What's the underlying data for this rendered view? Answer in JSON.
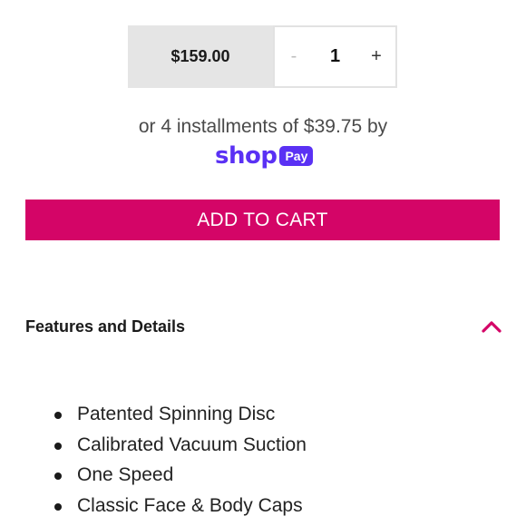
{
  "product": {
    "price": "$159.00",
    "quantity": {
      "minus_label": "-",
      "value": "1",
      "plus_label": "+"
    }
  },
  "installments": {
    "text": "or 4 installments of $39.75 by",
    "shop_word": "shop",
    "pay_badge": "Pay",
    "brand_color": "#5a31f4"
  },
  "cart": {
    "add_label": "ADD TO CART",
    "button_color": "#d40567"
  },
  "features": {
    "title": "Features and Details",
    "toggle_icon": "chevron-up-icon",
    "items": [
      "Patented Spinning Disc",
      "Calibrated Vacuum Suction",
      "One Speed",
      "Classic Face & Body Caps"
    ]
  }
}
